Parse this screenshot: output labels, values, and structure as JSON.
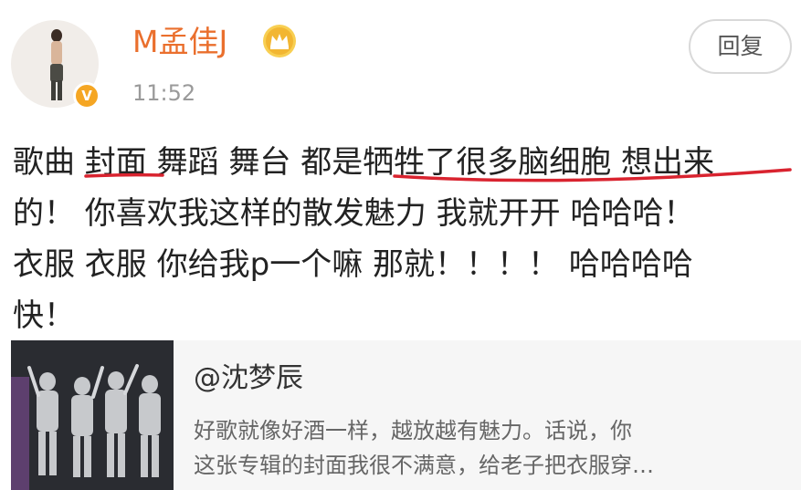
{
  "post": {
    "author": "M孟佳J",
    "time": "11:52",
    "reply_label": "回复",
    "text_lines": [
      "歌曲 封面 舞蹈 舞台 都是牺牲了很多脑细胞 想出来",
      "的！ 你喜欢我这样的散发魅力 我就开开 哈哈哈！",
      "衣服 衣服 你给我p一个嘛 那就！！！！ 哈哈哈哈",
      "快！"
    ]
  },
  "icons": {
    "avatar": "avatar",
    "verified": "verified-badge-icon",
    "crown": "crown-icon"
  },
  "quote": {
    "author": "@沈梦辰",
    "text_lines": [
      "好歌就像好酒一样，越放越有魅力。话说，你",
      "这张专辑的封面我很不满意，给老子把衣服穿…"
    ]
  },
  "colors": {
    "username": "#ea6f2d",
    "underline": "#d9232f",
    "verified": "#f5a623",
    "crown": "#f2b632"
  }
}
